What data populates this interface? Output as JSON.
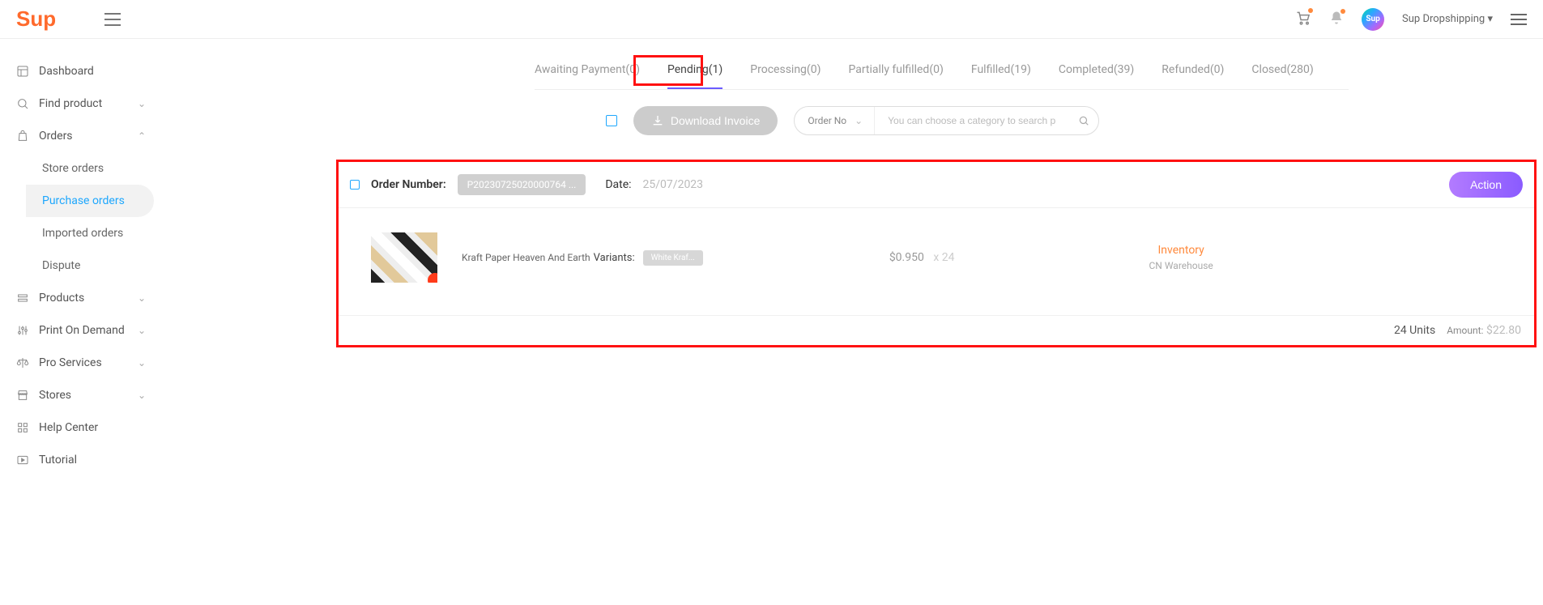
{
  "header": {
    "logo": "Sup",
    "username": "Sup Dropshipping",
    "avatar_text": "Sup"
  },
  "sidebar": {
    "items": [
      {
        "label": "Dashboard",
        "icon": "dashboard"
      },
      {
        "label": "Find product",
        "icon": "search",
        "expandable": true
      },
      {
        "label": "Orders",
        "icon": "cart",
        "expanded": true,
        "children": [
          {
            "label": "Store orders"
          },
          {
            "label": "Purchase orders",
            "active": true
          },
          {
            "label": "Imported orders"
          },
          {
            "label": "Dispute"
          }
        ]
      },
      {
        "label": "Products",
        "icon": "products",
        "expandable": true
      },
      {
        "label": "Print On Demand",
        "icon": "pod",
        "expandable": true
      },
      {
        "label": "Pro Services",
        "icon": "scales",
        "expandable": true
      },
      {
        "label": "Stores",
        "icon": "store",
        "expandable": true
      },
      {
        "label": "Help Center",
        "icon": "grid"
      },
      {
        "label": "Tutorial",
        "icon": "play"
      }
    ]
  },
  "tabs": [
    {
      "label": "Awaiting Payment",
      "count": 0
    },
    {
      "label": "Pending",
      "count": 1,
      "active": true
    },
    {
      "label": "Processing",
      "count": 0
    },
    {
      "label": "Partially fulfilled",
      "count": 0
    },
    {
      "label": "Fulfilled",
      "count": 19
    },
    {
      "label": "Completed",
      "count": 39
    },
    {
      "label": "Refunded",
      "count": 0
    },
    {
      "label": "Closed",
      "count": 280
    }
  ],
  "controls": {
    "download_label": "Download Invoice",
    "search_category": "Order No",
    "search_placeholder": "You can choose a category to search precisely"
  },
  "order": {
    "number_label": "Order Number:",
    "number": "P20230725020000764 ...",
    "date_label": "Date:",
    "date": "25/07/2023",
    "action_label": "Action",
    "product_name": "Kraft Paper Heaven And Earth",
    "variants_label": "Variants:",
    "variant_chip": "White Kraf...",
    "price": "$0.950",
    "qty": "x 24",
    "inventory_label": "Inventory",
    "warehouse": "CN Warehouse",
    "units": "24 Units",
    "amount_label": "Amount:",
    "amount": "$22.80"
  }
}
